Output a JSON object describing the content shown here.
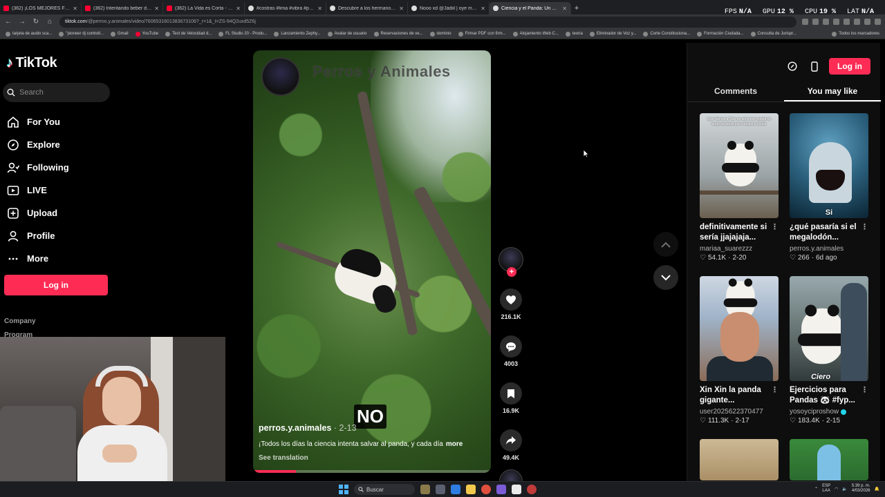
{
  "browser": {
    "tabs": [
      {
        "title": "(362) ¡LOS MEJORES FRIJOLES",
        "favicon": "youtube-favicon",
        "active": false
      },
      {
        "title": "(362) Intentando beber de un b",
        "favicon": "youtube-favicon",
        "active": false
      },
      {
        "title": "(362) La Vida es Corta - Dante",
        "favicon": "youtube-favicon",
        "active": false
      },
      {
        "title": "#costras #lima #vibra #peruse",
        "favicon": "tiktok-favicon",
        "active": false
      },
      {
        "title": "Descubre a los hermanos Way",
        "favicon": "tiktok-favicon",
        "active": false
      },
      {
        "title": "Nooo xd @Jadiil | oye mañana",
        "favicon": "tiktok-favicon",
        "active": false
      },
      {
        "title": "Ciencia y el Panda: Un Esfu",
        "favicon": "tiktok-favicon",
        "active": true
      }
    ],
    "url_host": "tiktok.com",
    "url_path": "/@perros.y.animales/video/7606531601383673106?_r=1&_t=ZS-94Q2uxd5Z6j",
    "bookmarks": [
      "tarjeta de audio sca...",
      "\"pioneer dj controll...",
      "Gmail",
      "YouTube",
      "Test de Velocidad d...",
      "FL Studio 20 - Produ...",
      "Lanzamiento Zephy...",
      "Avatar de usuario",
      "Reservaciones de ve...",
      "dominio",
      "Firmar PDF con firm...",
      "Alojamiento Web C...",
      "teoria",
      "Eliminador de Voz y...",
      "Corte Constituciona...",
      "Formación Ciudada...",
      "Consulta de Jurispr..."
    ],
    "bookmarks_all": "Todos los marcadores"
  },
  "stats_overlay": [
    {
      "label": "FPS",
      "value": "N/A"
    },
    {
      "label": "GPU",
      "value": "12 %"
    },
    {
      "label": "CPU",
      "value": "19 %"
    },
    {
      "label": "LAT",
      "value": "N/A"
    }
  ],
  "tiktok": {
    "logo_text": "TikTok",
    "search_placeholder": "Search",
    "nav": [
      {
        "label": "For You",
        "icon": "home-icon"
      },
      {
        "label": "Explore",
        "icon": "compass-icon"
      },
      {
        "label": "Following",
        "icon": "following-icon"
      },
      {
        "label": "LIVE",
        "icon": "live-icon"
      },
      {
        "label": "Upload",
        "icon": "upload-icon"
      },
      {
        "label": "Profile",
        "icon": "profile-icon"
      },
      {
        "label": "More",
        "icon": "more-icon"
      }
    ],
    "login_label": "Log in",
    "footer": {
      "company": "Company",
      "program": "Program"
    }
  },
  "video": {
    "watermark": "Perros y Animales",
    "caption_overlay": "NO",
    "author": "perros.y.animales",
    "date": "· 2-13",
    "description": "¡Todos los días la ciencia intenta salvar al panda, y cada día",
    "more_label": "more",
    "see_translation": "See translation",
    "progress_percent": 18
  },
  "actions": {
    "likes": "216.1K",
    "comments": "4003",
    "saves": "16.9K",
    "shares": "49.4K"
  },
  "right_panel": {
    "login_label": "Log in",
    "tabs": [
      "Comments",
      "You may like"
    ],
    "active_tab": 1,
    "cards": [
      {
        "title": "definitivamente si sería jjajajaja...",
        "creator": "mariaa_suarezzz",
        "likes": "54.1K",
        "date": "2-20",
        "verified": false,
        "overlay": "",
        "caption": "Ayer fuimos a Tlan en serio ese panda no tengo pruebas pero tampoco dudas"
      },
      {
        "title": "¿qué pasaría si el megalodón...",
        "creator": "perros.y.animales",
        "likes": "266",
        "date": "6d ago",
        "verified": false,
        "overlay": "Si",
        "caption": ""
      },
      {
        "title": "Xin Xin la panda gigante...",
        "creator": "user2025622370477",
        "likes": "111.3K",
        "date": "2-17",
        "verified": false,
        "overlay": "",
        "caption": ""
      },
      {
        "title": "Ejercicios para Pandas 🐼 #fyp...",
        "creator": "yosoyciproshow",
        "likes": "183.4K",
        "date": "2-15",
        "verified": true,
        "overlay": "Ciero",
        "caption": ""
      },
      {
        "title": "",
        "creator": "",
        "likes": "",
        "date": "",
        "verified": false,
        "overlay": "",
        "caption": ""
      },
      {
        "title": "",
        "creator": "",
        "likes": "",
        "date": "",
        "verified": false,
        "overlay": "",
        "caption": ""
      }
    ]
  },
  "taskbar": {
    "search_label": "Buscar",
    "tray_lang_top": "ESP",
    "tray_lang_bottom": "LAA",
    "time": "5:39 p. m.",
    "date": "4/03/2026"
  },
  "colors": {
    "accent": "#fe2c55",
    "background": "#000000",
    "panel": "#0e0e0e"
  }
}
